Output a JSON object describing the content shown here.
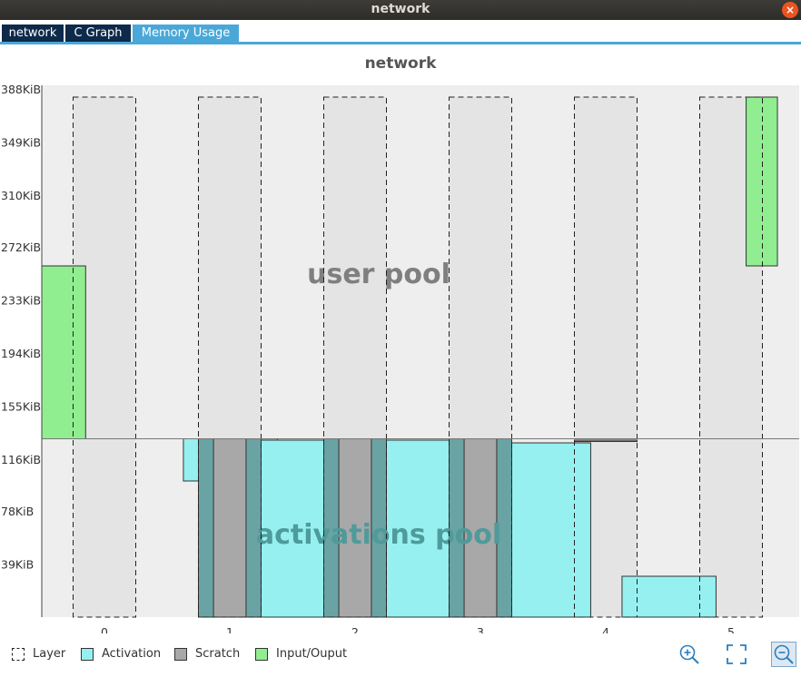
{
  "window": {
    "title": "network",
    "close_glyph": "×"
  },
  "tabs": [
    {
      "label": "network",
      "active": false
    },
    {
      "label": "C Graph",
      "active": false
    },
    {
      "label": "Memory Usage",
      "active": true
    }
  ],
  "colors": {
    "layer": "#000000",
    "activation": "#96f0f0",
    "scratch": "#a8a8a8",
    "io": "#90ee90",
    "edge_dark": "#6aa3a3",
    "bg": "#eeeeee",
    "tab_dark": "#0e2a4a",
    "tab_active": "#4aa8d8"
  },
  "chart_data": {
    "type": "memory-layout",
    "title": "network",
    "ylim": [
      0,
      388
    ],
    "y_unit": "KiB",
    "y_ticks": [
      "388KiB",
      "349KiB",
      "310KiB",
      "272KiB",
      "233KiB",
      "194KiB",
      "155KiB",
      "116KiB",
      "78KiB",
      "39KiB"
    ],
    "y_tick_values": [
      388,
      349,
      310,
      272,
      233,
      194,
      155,
      116,
      78,
      39
    ],
    "x_ticks": [
      "0",
      "1",
      "2",
      "3",
      "4",
      "5"
    ],
    "xlim": [
      -0.5,
      5.5
    ],
    "pool_boundary": 131,
    "pool_labels": {
      "user": "user pool",
      "activations": "activations pool"
    },
    "layers": [
      {
        "x0": -0.25,
        "x1": 0.25,
        "y0": 0,
        "y1": 382
      },
      {
        "x0": 0.75,
        "x1": 1.25,
        "y0": 0,
        "y1": 382
      },
      {
        "x0": 1.75,
        "x1": 2.25,
        "y0": 0,
        "y1": 382
      },
      {
        "x0": 2.75,
        "x1": 3.25,
        "y0": 0,
        "y1": 382
      },
      {
        "x0": 3.75,
        "x1": 4.25,
        "y0": 0,
        "y1": 382
      },
      {
        "x0": 4.75,
        "x1": 5.25,
        "y0": 0,
        "y1": 382
      }
    ],
    "io_buffers": [
      {
        "x0": -0.5,
        "x1": -0.15,
        "y0": 131,
        "y1": 258
      },
      {
        "x0": 5.12,
        "x1": 5.37,
        "y0": 258,
        "y1": 382
      }
    ],
    "activations": [
      {
        "x0": 0.63,
        "x1": 1.38,
        "y0": 100,
        "y1": 131
      },
      {
        "x0": 1.25,
        "x1": 1.88,
        "y0": 0,
        "y1": 130
      },
      {
        "x0": 2.25,
        "x1": 2.88,
        "y0": 0,
        "y1": 130
      },
      {
        "x0": 3.25,
        "x1": 3.88,
        "y0": 0,
        "y1": 128
      },
      {
        "x0": 4.13,
        "x1": 4.88,
        "y0": 0,
        "y1": 30
      }
    ],
    "scratch": [
      {
        "x0": 0.75,
        "x1": 1.25,
        "y0": 0,
        "y1": 131
      },
      {
        "x0": 1.75,
        "x1": 2.25,
        "y0": 0,
        "y1": 131
      },
      {
        "x0": 2.75,
        "x1": 3.25,
        "y0": 0,
        "y1": 131
      },
      {
        "x0": 3.75,
        "x1": 4.25,
        "y0": 129,
        "y1": 130
      }
    ],
    "legend": [
      {
        "label": "Layer",
        "kind": "layer"
      },
      {
        "label": "Activation",
        "kind": "activation"
      },
      {
        "label": "Scratch",
        "kind": "scratch"
      },
      {
        "label": "Input/Ouput",
        "kind": "io"
      }
    ]
  },
  "toolbar": {
    "zoom_in": "zoom-in-icon",
    "fit": "fit-view-icon",
    "zoom_out": "zoom-out-icon"
  }
}
